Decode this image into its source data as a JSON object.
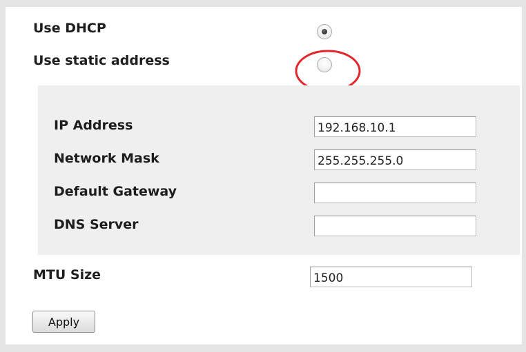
{
  "network": {
    "dhcp_label": "Use DHCP",
    "static_label": "Use static address",
    "selected_mode": "dhcp",
    "static_settings": {
      "ip_label": "IP Address",
      "ip_value": "192.168.10.1",
      "mask_label": "Network Mask",
      "mask_value": "255.255.255.0",
      "gateway_label": "Default Gateway",
      "gateway_value": "",
      "dns_label": "DNS Server",
      "dns_value": ""
    },
    "mtu_label": "MTU Size",
    "mtu_value": "1500",
    "apply_label": "Apply"
  },
  "annotation": {
    "highlight_color": "#e3262b",
    "highlight_target": "static-address-radio"
  }
}
